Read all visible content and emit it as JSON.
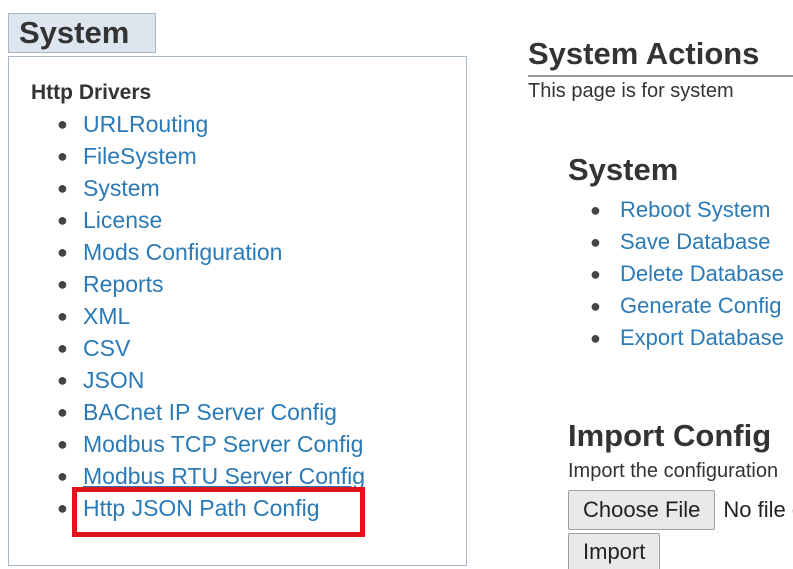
{
  "sidebar": {
    "title": "System",
    "section_heading": "Http Drivers",
    "items": [
      {
        "label": "URLRouting"
      },
      {
        "label": "FileSystem"
      },
      {
        "label": "System"
      },
      {
        "label": "License"
      },
      {
        "label": "Mods Configuration"
      },
      {
        "label": "Reports"
      },
      {
        "label": "XML"
      },
      {
        "label": "CSV"
      },
      {
        "label": "JSON"
      },
      {
        "label": "BACnet IP Server Config"
      },
      {
        "label": "Modbus TCP Server Config"
      },
      {
        "label": "Modbus RTU Server Config"
      },
      {
        "label": "Http JSON Path Config"
      }
    ],
    "highlighted_item": "Http JSON Path Config",
    "highlight_color": "#e0141b",
    "link_color": "#2a7ab7"
  },
  "main": {
    "title": "System Actions",
    "description": "This page is for system",
    "system_section": {
      "title": "System",
      "actions": [
        {
          "label": "Reboot System"
        },
        {
          "label": "Save Database"
        },
        {
          "label": "Delete Database"
        },
        {
          "label": "Generate Config"
        },
        {
          "label": "Export Database"
        }
      ]
    },
    "import_section": {
      "title": "Import Config",
      "description": "Import the configuration",
      "choose_file_label": "Choose File",
      "file_status": "No file chosen",
      "import_label": "Import"
    }
  }
}
